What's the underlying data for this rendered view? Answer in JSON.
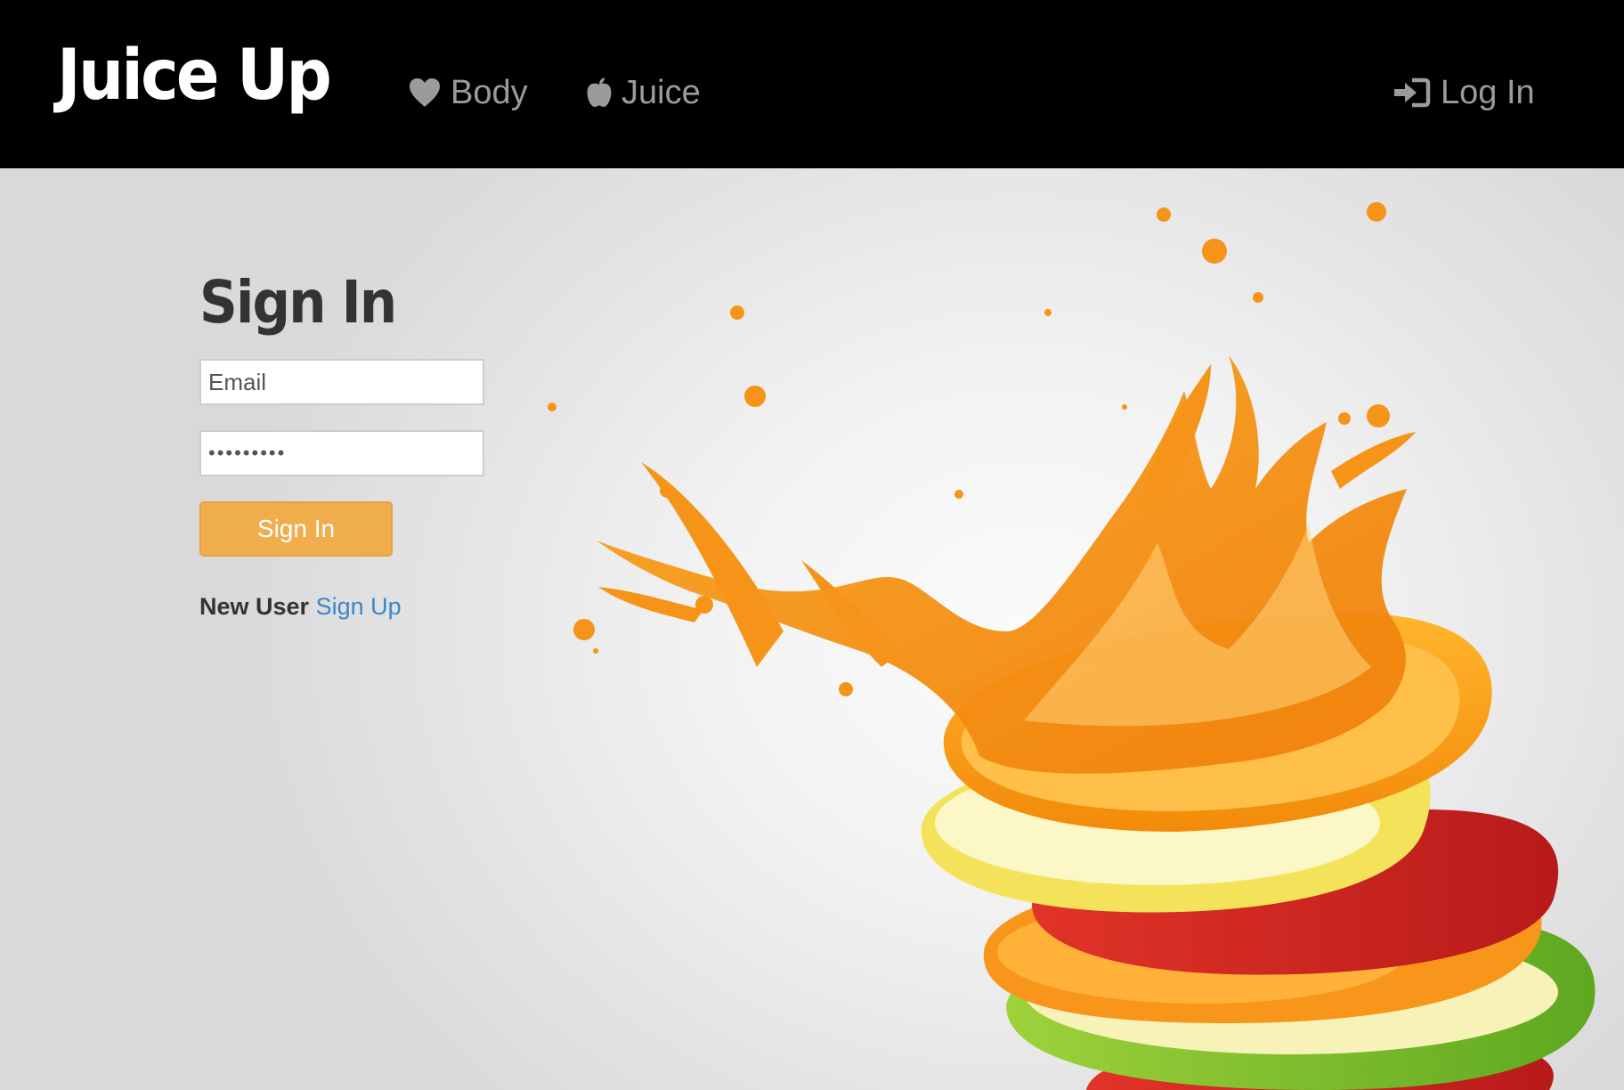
{
  "navbar": {
    "brand": "Juice Up",
    "links": [
      {
        "label": "Body",
        "icon": "heart-icon"
      },
      {
        "label": "Juice",
        "icon": "apple-icon"
      }
    ],
    "login": {
      "label": "Log In",
      "icon": "login-icon"
    }
  },
  "signin": {
    "title": "Sign In",
    "email_placeholder": "Email",
    "password_value": "•••••••••",
    "button_label": "Sign In",
    "new_user_label": "New User",
    "signup_link": "Sign Up"
  },
  "colors": {
    "navbar_bg": "#000000",
    "nav_text": "#9b9b9b",
    "button_bg": "#f0ad4e",
    "link": "#3a86c8",
    "title": "#333333"
  },
  "hero": {
    "image": "fruit-slices-juice-splash"
  }
}
